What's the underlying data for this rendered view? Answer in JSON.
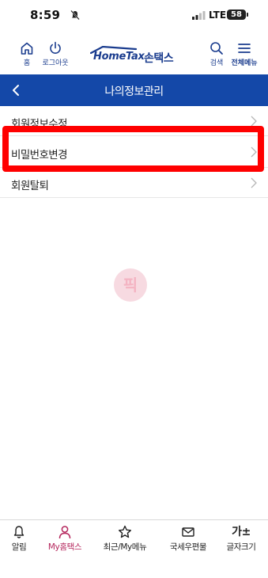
{
  "status_bar": {
    "time": "8:59",
    "network": "LTE",
    "battery": "58"
  },
  "header": {
    "home_label": "홈",
    "logout_label": "로그아웃",
    "logo_en": "HomeTax",
    "logo_ko": "손택스",
    "search_label": "검색",
    "allmenu_label": "전체메뉴"
  },
  "titlebar": {
    "title": "나의정보관리"
  },
  "menu": {
    "items": [
      {
        "label": "회원정보수정"
      },
      {
        "label": "비밀번호변경"
      },
      {
        "label": "회원탈퇴"
      }
    ]
  },
  "watermark": {
    "text": "픽"
  },
  "tabbar": {
    "tabs": [
      {
        "label": "알림"
      },
      {
        "label": "My홈택스"
      },
      {
        "label": "최근/My메뉴"
      },
      {
        "label": "국세우편물"
      },
      {
        "label": "글자크기",
        "glyph": "가±"
      }
    ]
  },
  "colors": {
    "brand_blue": "#1448a8",
    "logo_blue": "#1a3c8e",
    "active_tab": "#b5275d",
    "highlight_red": "#ff0000"
  }
}
